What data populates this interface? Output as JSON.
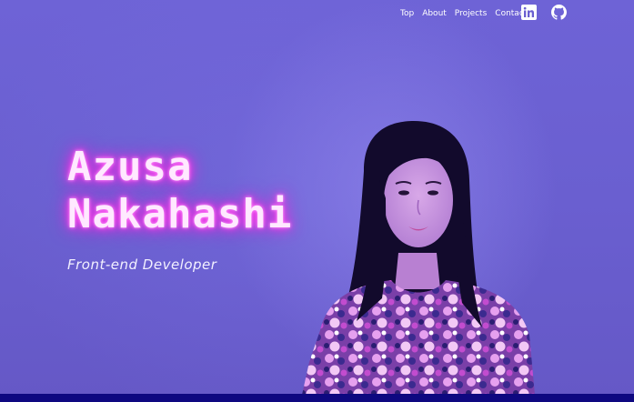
{
  "nav": {
    "links": [
      {
        "label": "Top"
      },
      {
        "label": "About"
      },
      {
        "label": "Projects"
      },
      {
        "label": "Contact"
      }
    ],
    "icons": {
      "linkedin": "linkedin-icon",
      "github": "github-icon"
    }
  },
  "hero": {
    "name_line1": "Azusa",
    "name_line2": "Nakahashi",
    "subtitle": "Front-end Developer"
  },
  "colors": {
    "background": "#6a5fd0",
    "neon_glow": "#ff2ee6",
    "bottom_bar": "#0e0880",
    "nav_text": "#ffffff"
  }
}
